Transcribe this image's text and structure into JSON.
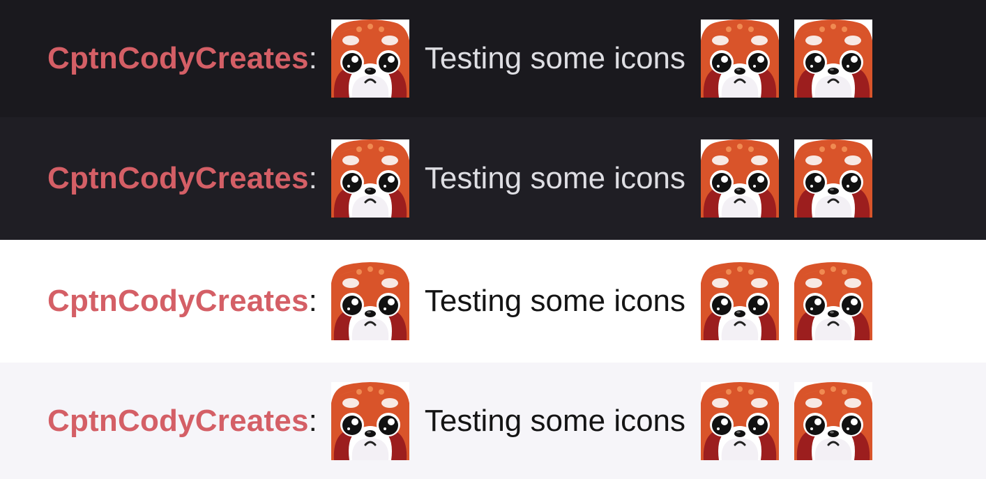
{
  "rows": [
    {
      "theme": "dark",
      "username": "CptnCodyCreates",
      "separator": ":",
      "message": "Testing some icons",
      "emotes": [
        "red-panda-emote",
        "red-panda-emote",
        "red-panda-emote"
      ]
    },
    {
      "theme": "dark",
      "username": "CptnCodyCreates",
      "separator": ":",
      "message": "Testing some icons",
      "emotes": [
        "red-panda-emote",
        "red-panda-emote",
        "red-panda-emote"
      ]
    },
    {
      "theme": "light",
      "username": "CptnCodyCreates",
      "separator": ":",
      "message": "Testing some icons",
      "emotes": [
        "red-panda-emote",
        "red-panda-emote",
        "red-panda-emote"
      ]
    },
    {
      "theme": "light",
      "username": "CptnCodyCreates",
      "separator": ":",
      "message": "Testing some icons",
      "emotes": [
        "red-panda-emote",
        "red-panda-emote",
        "red-panda-emote"
      ]
    }
  ],
  "colors": {
    "username": "#d45f66",
    "dark_bg_1": "#1a191e",
    "dark_bg_2": "#1f1e24",
    "light_bg_1": "#ffffff",
    "light_bg_2": "#f6f5f9",
    "dark_text": "#dedee3",
    "light_text": "#141414"
  }
}
